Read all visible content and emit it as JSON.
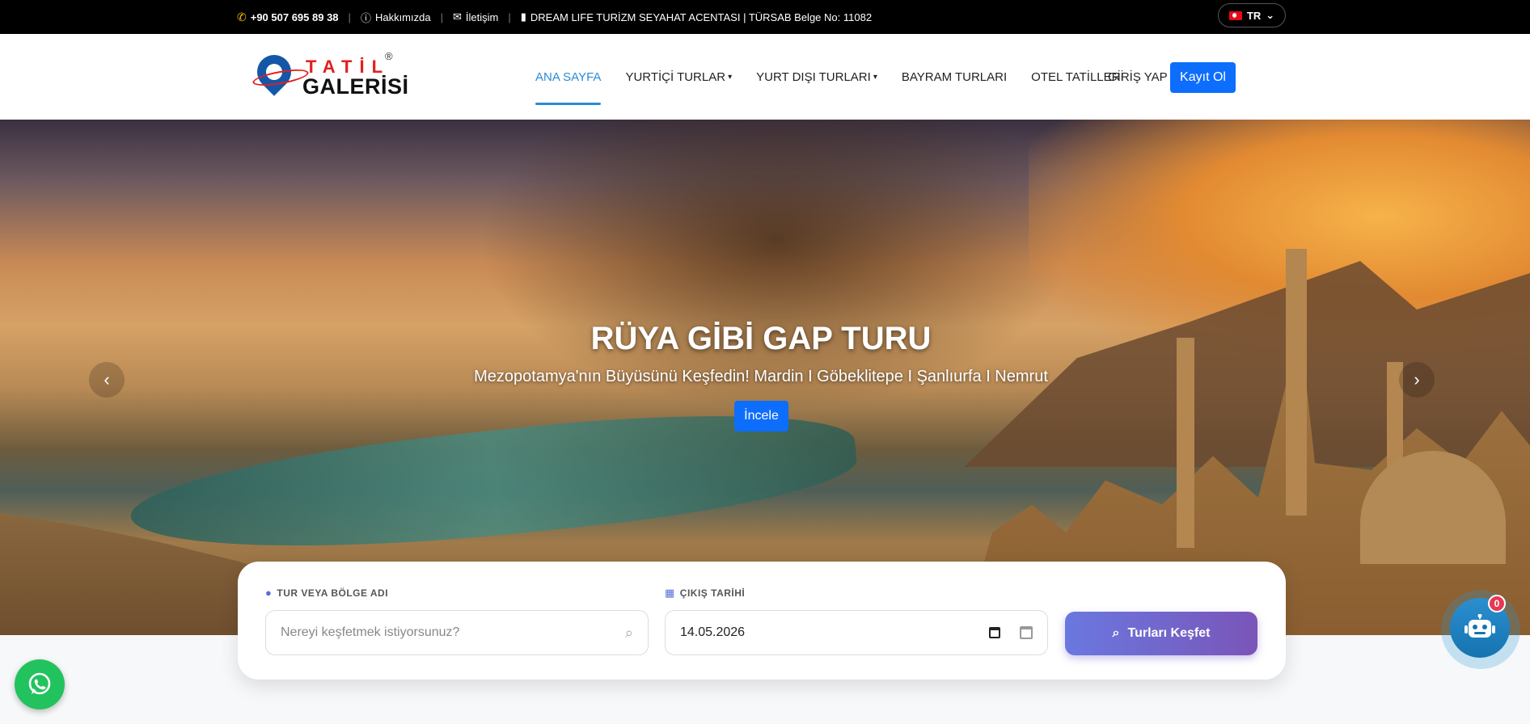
{
  "topbar": {
    "phone": "+90 507 695 89 38",
    "about": "Hakkımızda",
    "contact": "İletişim",
    "agency": "DREAM LIFE TURİZM SEYAHAT ACENTASI | TÜRSAB Belge No: 11082",
    "language": "TR",
    "sep": "|"
  },
  "logo": {
    "line1": "TATİL",
    "line2": "GALERİSİ",
    "reg": "®"
  },
  "nav": {
    "items": [
      {
        "label": "ANA SAYFA"
      },
      {
        "label": "YURTİÇİ TURLAR"
      },
      {
        "label": "YURT DIŞI TURLARI"
      },
      {
        "label": "BAYRAM TURLARI"
      },
      {
        "label": "OTEL TATİLLERİ"
      }
    ],
    "caret": "▾",
    "login": "GİRİŞ YAP",
    "register": "Kayıt Ol"
  },
  "hero": {
    "title": "RÜYA GİBİ GAP TURU",
    "subtitle": "Mezopotamya'nın Büyüsünü Keşfedin! Mardin I Göbeklitepe I Şanlıurfa I Nemrut",
    "button": "İncele",
    "prev": "‹",
    "next": "›"
  },
  "search": {
    "destination_label": "TUR VEYA BÖLGE ADI",
    "destination_placeholder": "Nereyi keşfetmek istiyorsunuz?",
    "date_label": "ÇIKIŞ TARİHİ",
    "date_value": "14.05.2026",
    "button": "Turları Keşfet"
  },
  "chatbot": {
    "badge": "0"
  },
  "colors": {
    "primary": "#0d6efd",
    "active": "#2a8bd6",
    "whatsapp": "#22c35e",
    "badge": "#e63952"
  }
}
